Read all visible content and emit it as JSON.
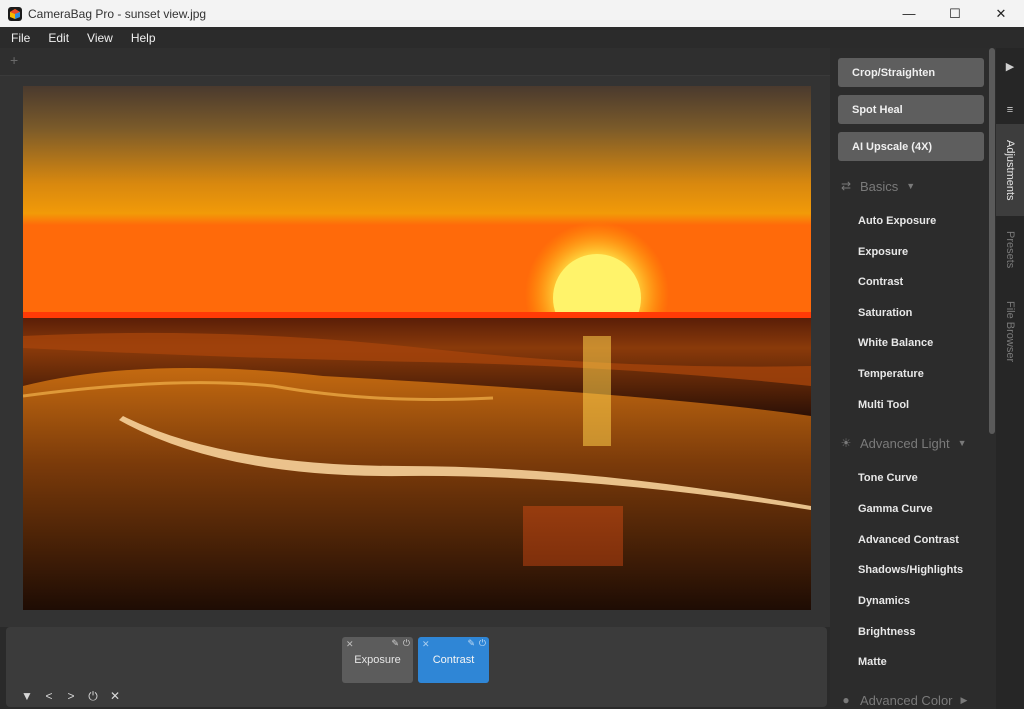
{
  "window": {
    "title": "CameraBag Pro - sunset view.jpg",
    "controls": {
      "minimize": "—",
      "maximize": "☐",
      "close": "✕"
    }
  },
  "menu": [
    "File",
    "Edit",
    "View",
    "Help"
  ],
  "tabstrip": {
    "add_label": "+"
  },
  "layers": [
    {
      "label": "Exposure",
      "active": false
    },
    {
      "label": "Contrast",
      "active": true
    }
  ],
  "bottom_tools": [
    "▼",
    "<",
    ">",
    "⏻",
    "✕"
  ],
  "sidebar": {
    "actions": [
      "Crop/Straighten",
      "Spot Heal",
      "AI Upscale (4X)"
    ],
    "sections": [
      {
        "title": "Basics",
        "icon": "sliders-icon",
        "items": [
          "Auto Exposure",
          "Exposure",
          "Contrast",
          "Saturation",
          "White Balance",
          "Temperature",
          "Multi Tool"
        ]
      },
      {
        "title": "Advanced Light",
        "icon": "sun-icon",
        "items": [
          "Tone Curve",
          "Gamma Curve",
          "Advanced Contrast",
          "Shadows/Highlights",
          "Dynamics",
          "Brightness",
          "Matte"
        ]
      },
      {
        "title": "Advanced Color",
        "icon": "color-icon",
        "items": []
      }
    ]
  },
  "side_tabs": {
    "buttons": [
      "▶",
      "≡"
    ],
    "tabs": [
      "Adjustments",
      "Presets",
      "File Browser"
    ],
    "active_tab": "Adjustments"
  },
  "colors": {
    "active_layer": "#2f86d6",
    "panel_bg": "#2c2c2c",
    "button_bg": "#5e5e5e"
  }
}
